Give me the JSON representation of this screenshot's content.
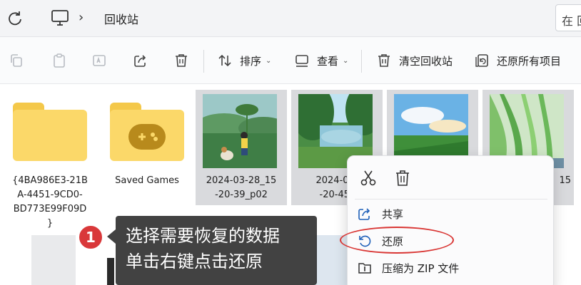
{
  "address_bar": {
    "breadcrumb_chevron": "›",
    "location": "回收站",
    "search_partial": "在 回"
  },
  "toolbar": {
    "sort_label": "排序",
    "view_label": "查看",
    "empty_recycle_bin_label": "清空回收站",
    "restore_all_label": "还原所有项目",
    "dropdown_glyph": "⌄"
  },
  "files": [
    {
      "name": "{4BA986E3-21BA-4451-9CD0-BD773E99F09D}",
      "type": "folder"
    },
    {
      "name": "Saved Games",
      "type": "folder-games"
    },
    {
      "name": "2024-03-28_15-20-39_p02",
      "type": "image"
    },
    {
      "name": "2024-03-28_15-20-45_",
      "type": "image"
    },
    {
      "name": "",
      "type": "image"
    },
    {
      "name": "15",
      "type": "image"
    }
  ],
  "file_labels": {
    "f0_line1": "{4BA986E3-21B",
    "f0_line2": "A-4451-9CD0-",
    "f0_line3": "BD773E99F09D",
    "f0_line4": "}",
    "f2_line1": "2024-03-28_15",
    "f2_line2": "-20-39_p02",
    "f3_line1": "2024-03-",
    "f3_line2": "-20-45_",
    "f5_line1": "15"
  },
  "context_menu": {
    "share_label": "共享",
    "restore_label": "还原",
    "compress_label": "压缩为 ZIP 文件"
  },
  "callout": {
    "step_number": "1",
    "line1": "选择需要恢复的数据",
    "line2": "单击右键点击还原"
  },
  "colors": {
    "accent": "#d9383a",
    "folder": "#fbd869",
    "selection": "#d9dadd"
  }
}
